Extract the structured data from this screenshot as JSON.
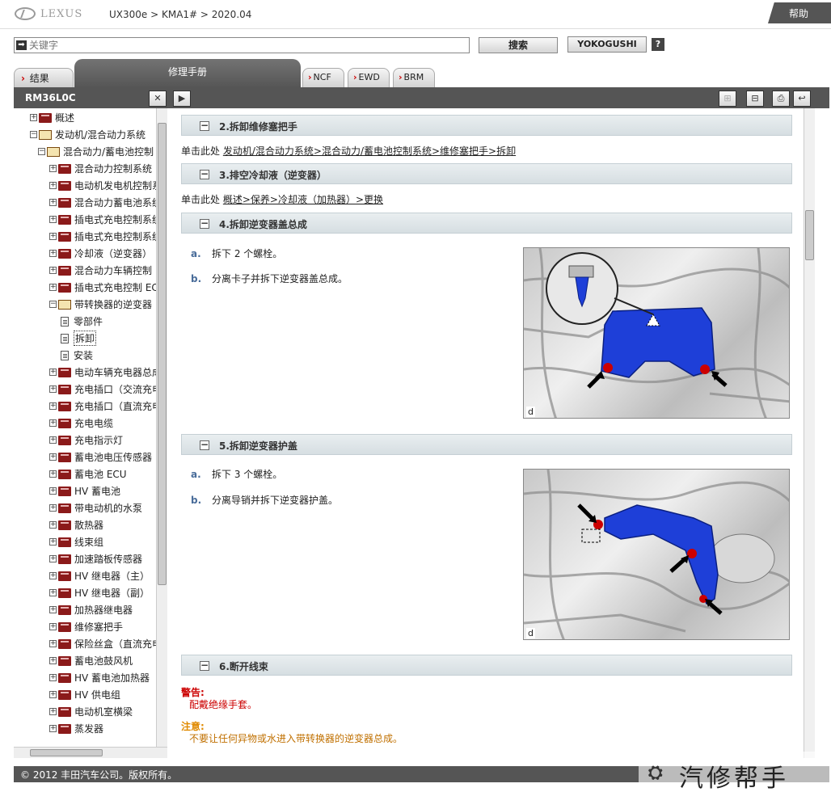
{
  "header": {
    "brand": "LEXUS",
    "breadcrumb": "UX300e > KMA1# > 2020.04",
    "help": "帮助"
  },
  "search": {
    "placeholder": "关键字",
    "search_button": "搜索",
    "yokogushi_button": "YOKOGUSHI",
    "help_button": "?"
  },
  "tabs": {
    "result": "结果",
    "manual": "修理手册",
    "ncf": "NCF",
    "ewd": "EWD",
    "brm": "BRM"
  },
  "toolbar": {
    "tree_title": "RM36L0C"
  },
  "tree": [
    {
      "label": "概述",
      "icon": "book",
      "exp": "+"
    },
    {
      "label": "发动机/混合动力系统",
      "icon": "book-open",
      "exp": "-"
    },
    {
      "label": "混合动力/蓄电池控制",
      "icon": "book-open",
      "exp": "-"
    },
    {
      "label": "混合动力控制系统",
      "icon": "book",
      "exp": "+"
    },
    {
      "label": "电动机发电机控制系",
      "icon": "book",
      "exp": "+"
    },
    {
      "label": "混合动力蓄电池系统",
      "icon": "book",
      "exp": "+"
    },
    {
      "label": "插电式充电控制系统",
      "icon": "book",
      "exp": "+"
    },
    {
      "label": "插电式充电控制系统",
      "icon": "book",
      "exp": "+"
    },
    {
      "label": "冷却液（逆变器）",
      "icon": "book",
      "exp": "+"
    },
    {
      "label": "混合动力车辆控制",
      "icon": "book",
      "exp": "+"
    },
    {
      "label": "插电式充电控制 EC",
      "icon": "book",
      "exp": "+"
    },
    {
      "label": "带转换器的逆变器",
      "icon": "book-open",
      "exp": "-"
    },
    {
      "label": "零部件",
      "icon": "page",
      "exp": ""
    },
    {
      "label": "拆卸",
      "icon": "page",
      "exp": ""
    },
    {
      "label": "安装",
      "icon": "page",
      "exp": ""
    },
    {
      "label": "电动车辆充电器总成",
      "icon": "book",
      "exp": "+"
    },
    {
      "label": "充电插口（交流充电",
      "icon": "book",
      "exp": "+"
    },
    {
      "label": "充电插口（直流充电",
      "icon": "book",
      "exp": "+"
    },
    {
      "label": "充电电缆",
      "icon": "book",
      "exp": "+"
    },
    {
      "label": "充电指示灯",
      "icon": "book",
      "exp": "+"
    },
    {
      "label": "蓄电池电压传感器",
      "icon": "book",
      "exp": "+"
    },
    {
      "label": "蓄电池 ECU",
      "icon": "book",
      "exp": "+"
    },
    {
      "label": "HV 蓄电池",
      "icon": "book",
      "exp": "+"
    },
    {
      "label": "带电动机的水泵",
      "icon": "book",
      "exp": "+"
    },
    {
      "label": "散热器",
      "icon": "book",
      "exp": "+"
    },
    {
      "label": "线束组",
      "icon": "book",
      "exp": "+"
    },
    {
      "label": "加速踏板传感器",
      "icon": "book",
      "exp": "+"
    },
    {
      "label": "HV 继电器（主）",
      "icon": "book",
      "exp": "+"
    },
    {
      "label": "HV 继电器（副）",
      "icon": "book",
      "exp": "+"
    },
    {
      "label": "加热器继电器",
      "icon": "book",
      "exp": "+"
    },
    {
      "label": "维修塞把手",
      "icon": "book",
      "exp": "+"
    },
    {
      "label": "保险丝盒（直流充电",
      "icon": "book",
      "exp": "+"
    },
    {
      "label": "蓄电池鼓风机",
      "icon": "book",
      "exp": "+"
    },
    {
      "label": "HV 蓄电池加热器",
      "icon": "book",
      "exp": "+"
    },
    {
      "label": "HV 供电组",
      "icon": "book",
      "exp": "+"
    },
    {
      "label": "电动机室横梁",
      "icon": "book",
      "exp": "+"
    },
    {
      "label": "蒸发器",
      "icon": "book",
      "exp": "+"
    }
  ],
  "content": {
    "s2_title": "2.拆卸维修塞把手",
    "s2_pre": "单击此处",
    "s2_link": "发动机/混合动力系统>混合动力/蓄电池控制系统>维修塞把手>拆卸",
    "s3_title": "3.排空冷却液（逆变器）",
    "s3_pre": "单击此处",
    "s3_link": "概述>保养>冷却液（加热器）>更换",
    "s4_title": "4.拆卸逆变器盖总成",
    "s4_a_lbl": "a.",
    "s4_a": "拆下 2 个螺栓。",
    "s4_b_lbl": "b.",
    "s4_b": "分离卡子并拆下逆变器盖总成。",
    "fig_label": "d",
    "s5_title": "5.拆卸逆变器护盖",
    "s5_a_lbl": "a.",
    "s5_a": "拆下 3 个螺栓。",
    "s5_b_lbl": "b.",
    "s5_b": "分离导销并拆下逆变器护盖。",
    "s6_title": "6.断开线束",
    "warn_title": "警告:",
    "warn_body": "配戴绝缘手套。",
    "note_title": "注意:",
    "note_body": "不要让任何异物或水进入带转换器的逆变器总成。"
  },
  "footer": {
    "copyright": "© 2012 丰田汽车公司。版权所有。"
  },
  "watermark": {
    "text": "汽修帮手"
  },
  "colors": {
    "toolbar": "#555555",
    "link_red": "#cc0000",
    "step_label": "#4a6d9a",
    "part_blue": "#1e3fd8",
    "bolt_red": "#cc0000"
  }
}
